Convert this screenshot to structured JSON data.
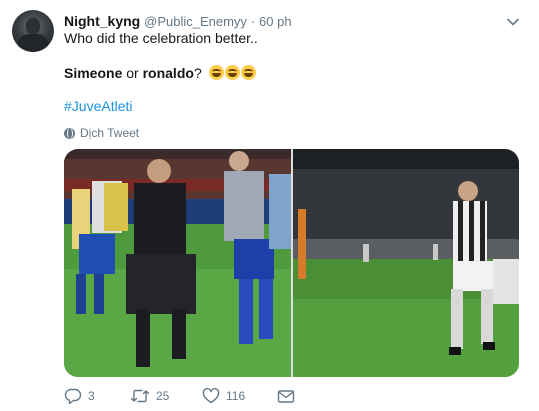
{
  "tweet": {
    "display_name": "Night_kyng",
    "handle": "@Public_Enemyy",
    "separator": "·",
    "time": "60 ph",
    "line1": "Who did the celebration better..",
    "name_a": "Simeone",
    "or_word": " or ",
    "name_b": "ronaldo",
    "question_mark": "?",
    "emojis": [
      "face-with-tears-of-joy",
      "face-with-tears-of-joy",
      "face-with-tears-of-joy"
    ],
    "hashtag": "#JuveAtleti",
    "translate_label": "Dịch Tweet"
  },
  "actions": {
    "reply_count": "3",
    "retweet_count": "25",
    "like_count": "116"
  },
  "colors": {
    "link": "#1b95e0",
    "secondary_text": "#657786",
    "primary_text": "#14171a"
  },
  "icons": {
    "menu": "chevron-down-icon",
    "translate": "globe-icon",
    "reply": "reply-icon",
    "retweet": "retweet-icon",
    "like": "heart-icon",
    "dm": "envelope-icon"
  }
}
